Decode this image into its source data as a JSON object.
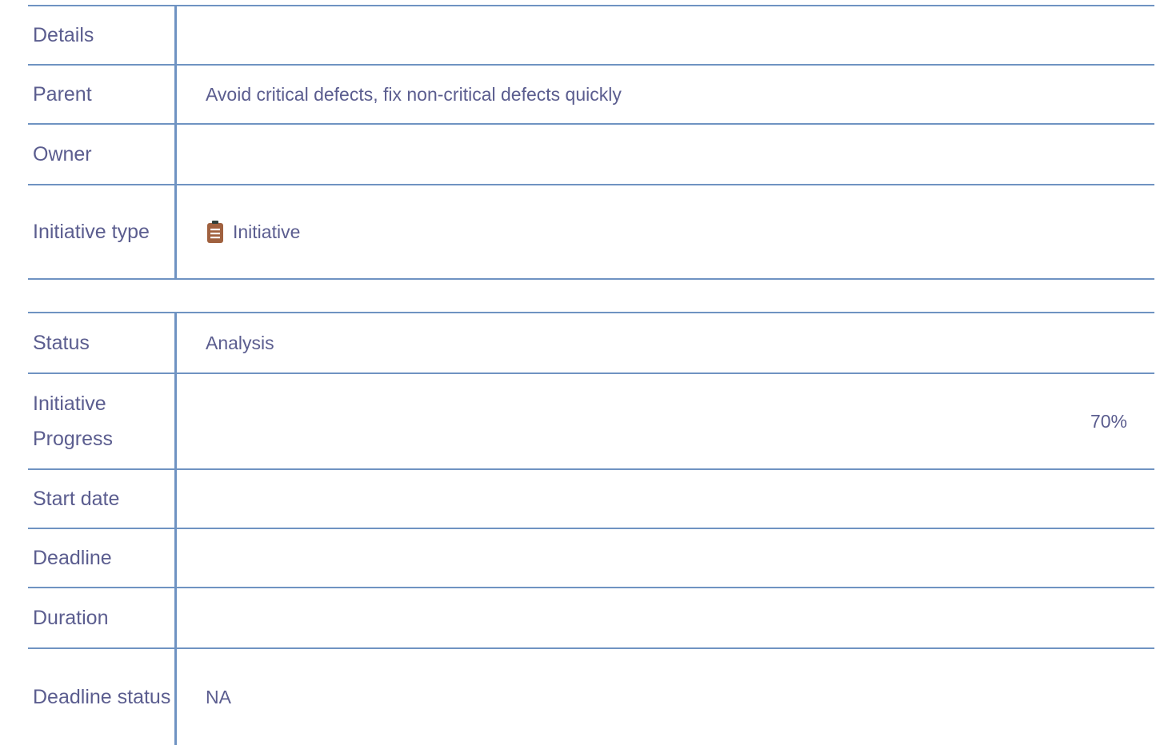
{
  "details_section": {
    "rows": [
      {
        "label": "Details",
        "value": ""
      },
      {
        "label": "Parent",
        "value": "Avoid critical defects, fix non-critical defects quickly"
      },
      {
        "label": "Owner",
        "value": ""
      },
      {
        "label": "Initiative type",
        "value": "Initiative",
        "icon": "clipboard-icon"
      }
    ]
  },
  "status_section": {
    "rows": [
      {
        "label": "Status",
        "value": "Analysis"
      },
      {
        "label": "Initiative Progress",
        "value": "70%",
        "progress_fraction": 0.7
      },
      {
        "label": "Start date",
        "value": ""
      },
      {
        "label": "Deadline",
        "value": ""
      },
      {
        "label": "Duration",
        "value": ""
      },
      {
        "label": "Deadline status",
        "value": "NA"
      }
    ]
  },
  "colors": {
    "border": "#6f93c2",
    "text": "#5b5d8f",
    "icon": "#a0613f"
  }
}
